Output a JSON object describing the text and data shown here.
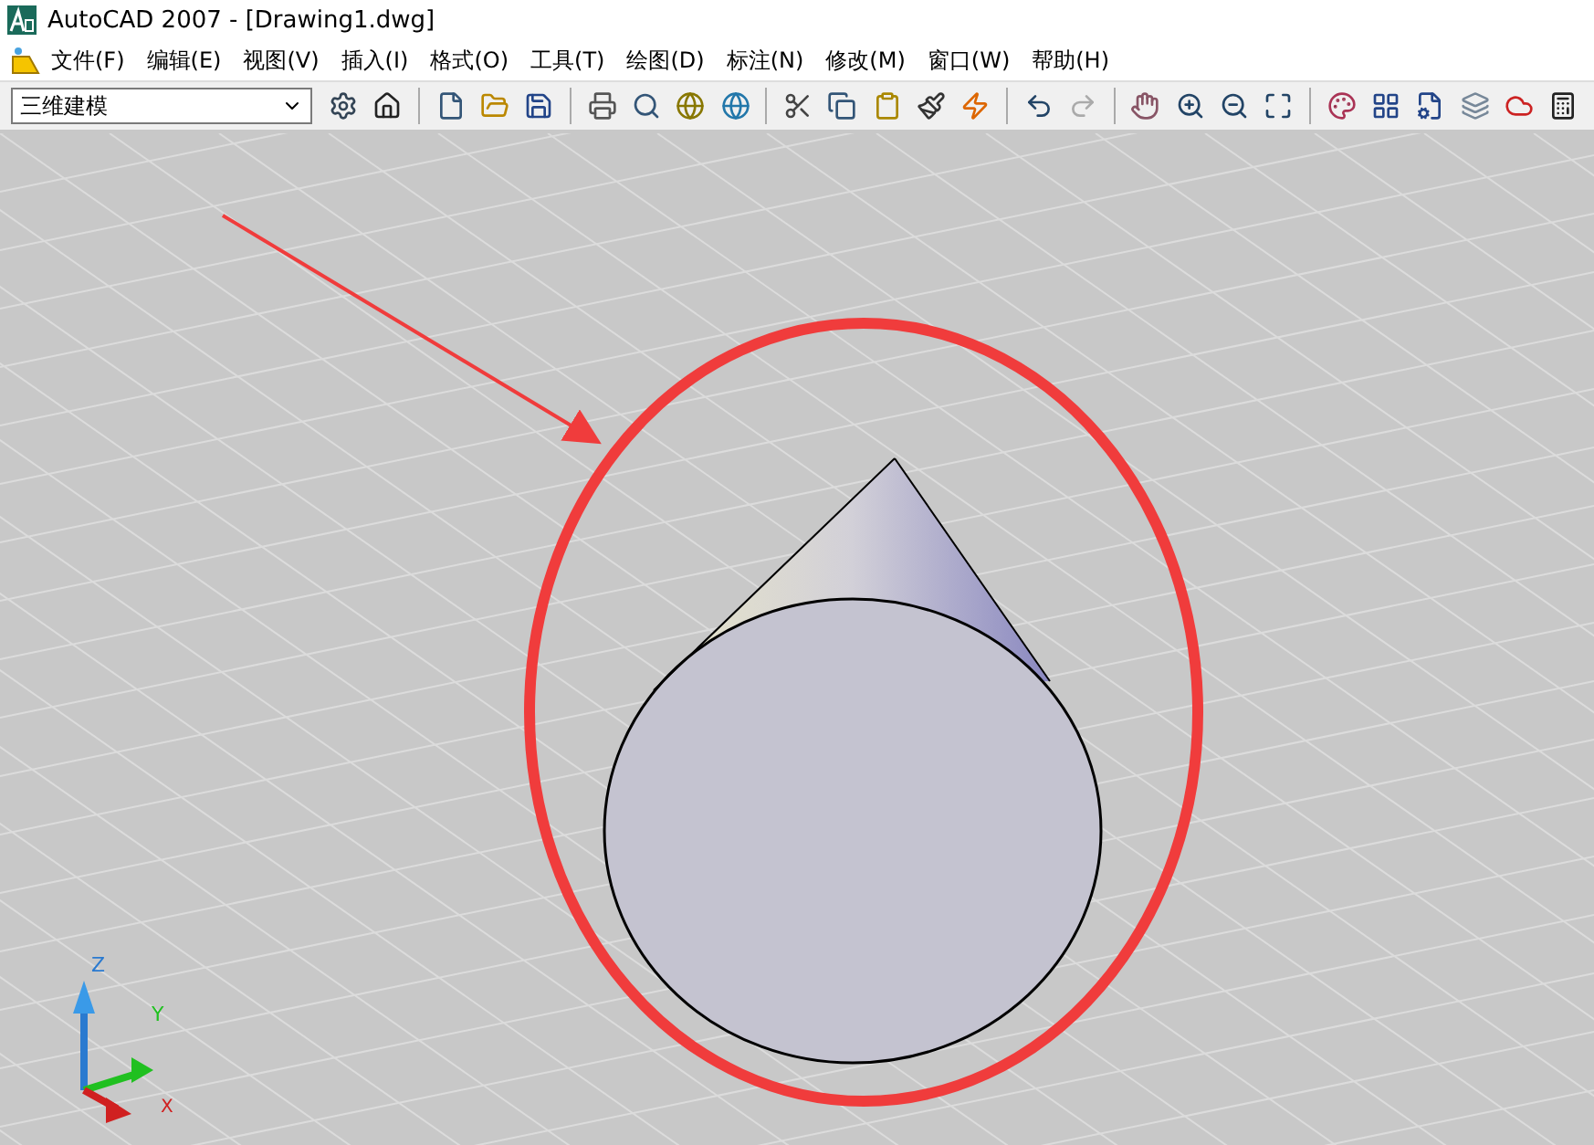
{
  "window": {
    "title": "AutoCAD 2007 - [Drawing1.dwg]"
  },
  "menu": [
    "文件(F)",
    "编辑(E)",
    "视图(V)",
    "插入(I)",
    "格式(O)",
    "工具(T)",
    "绘图(D)",
    "标注(N)",
    "修改(M)",
    "窗口(W)",
    "帮助(H)"
  ],
  "toolbar": {
    "workspace": "三维建模"
  },
  "ucs": {
    "z_label": "Z",
    "y_label": "Y",
    "x_label": "X"
  }
}
